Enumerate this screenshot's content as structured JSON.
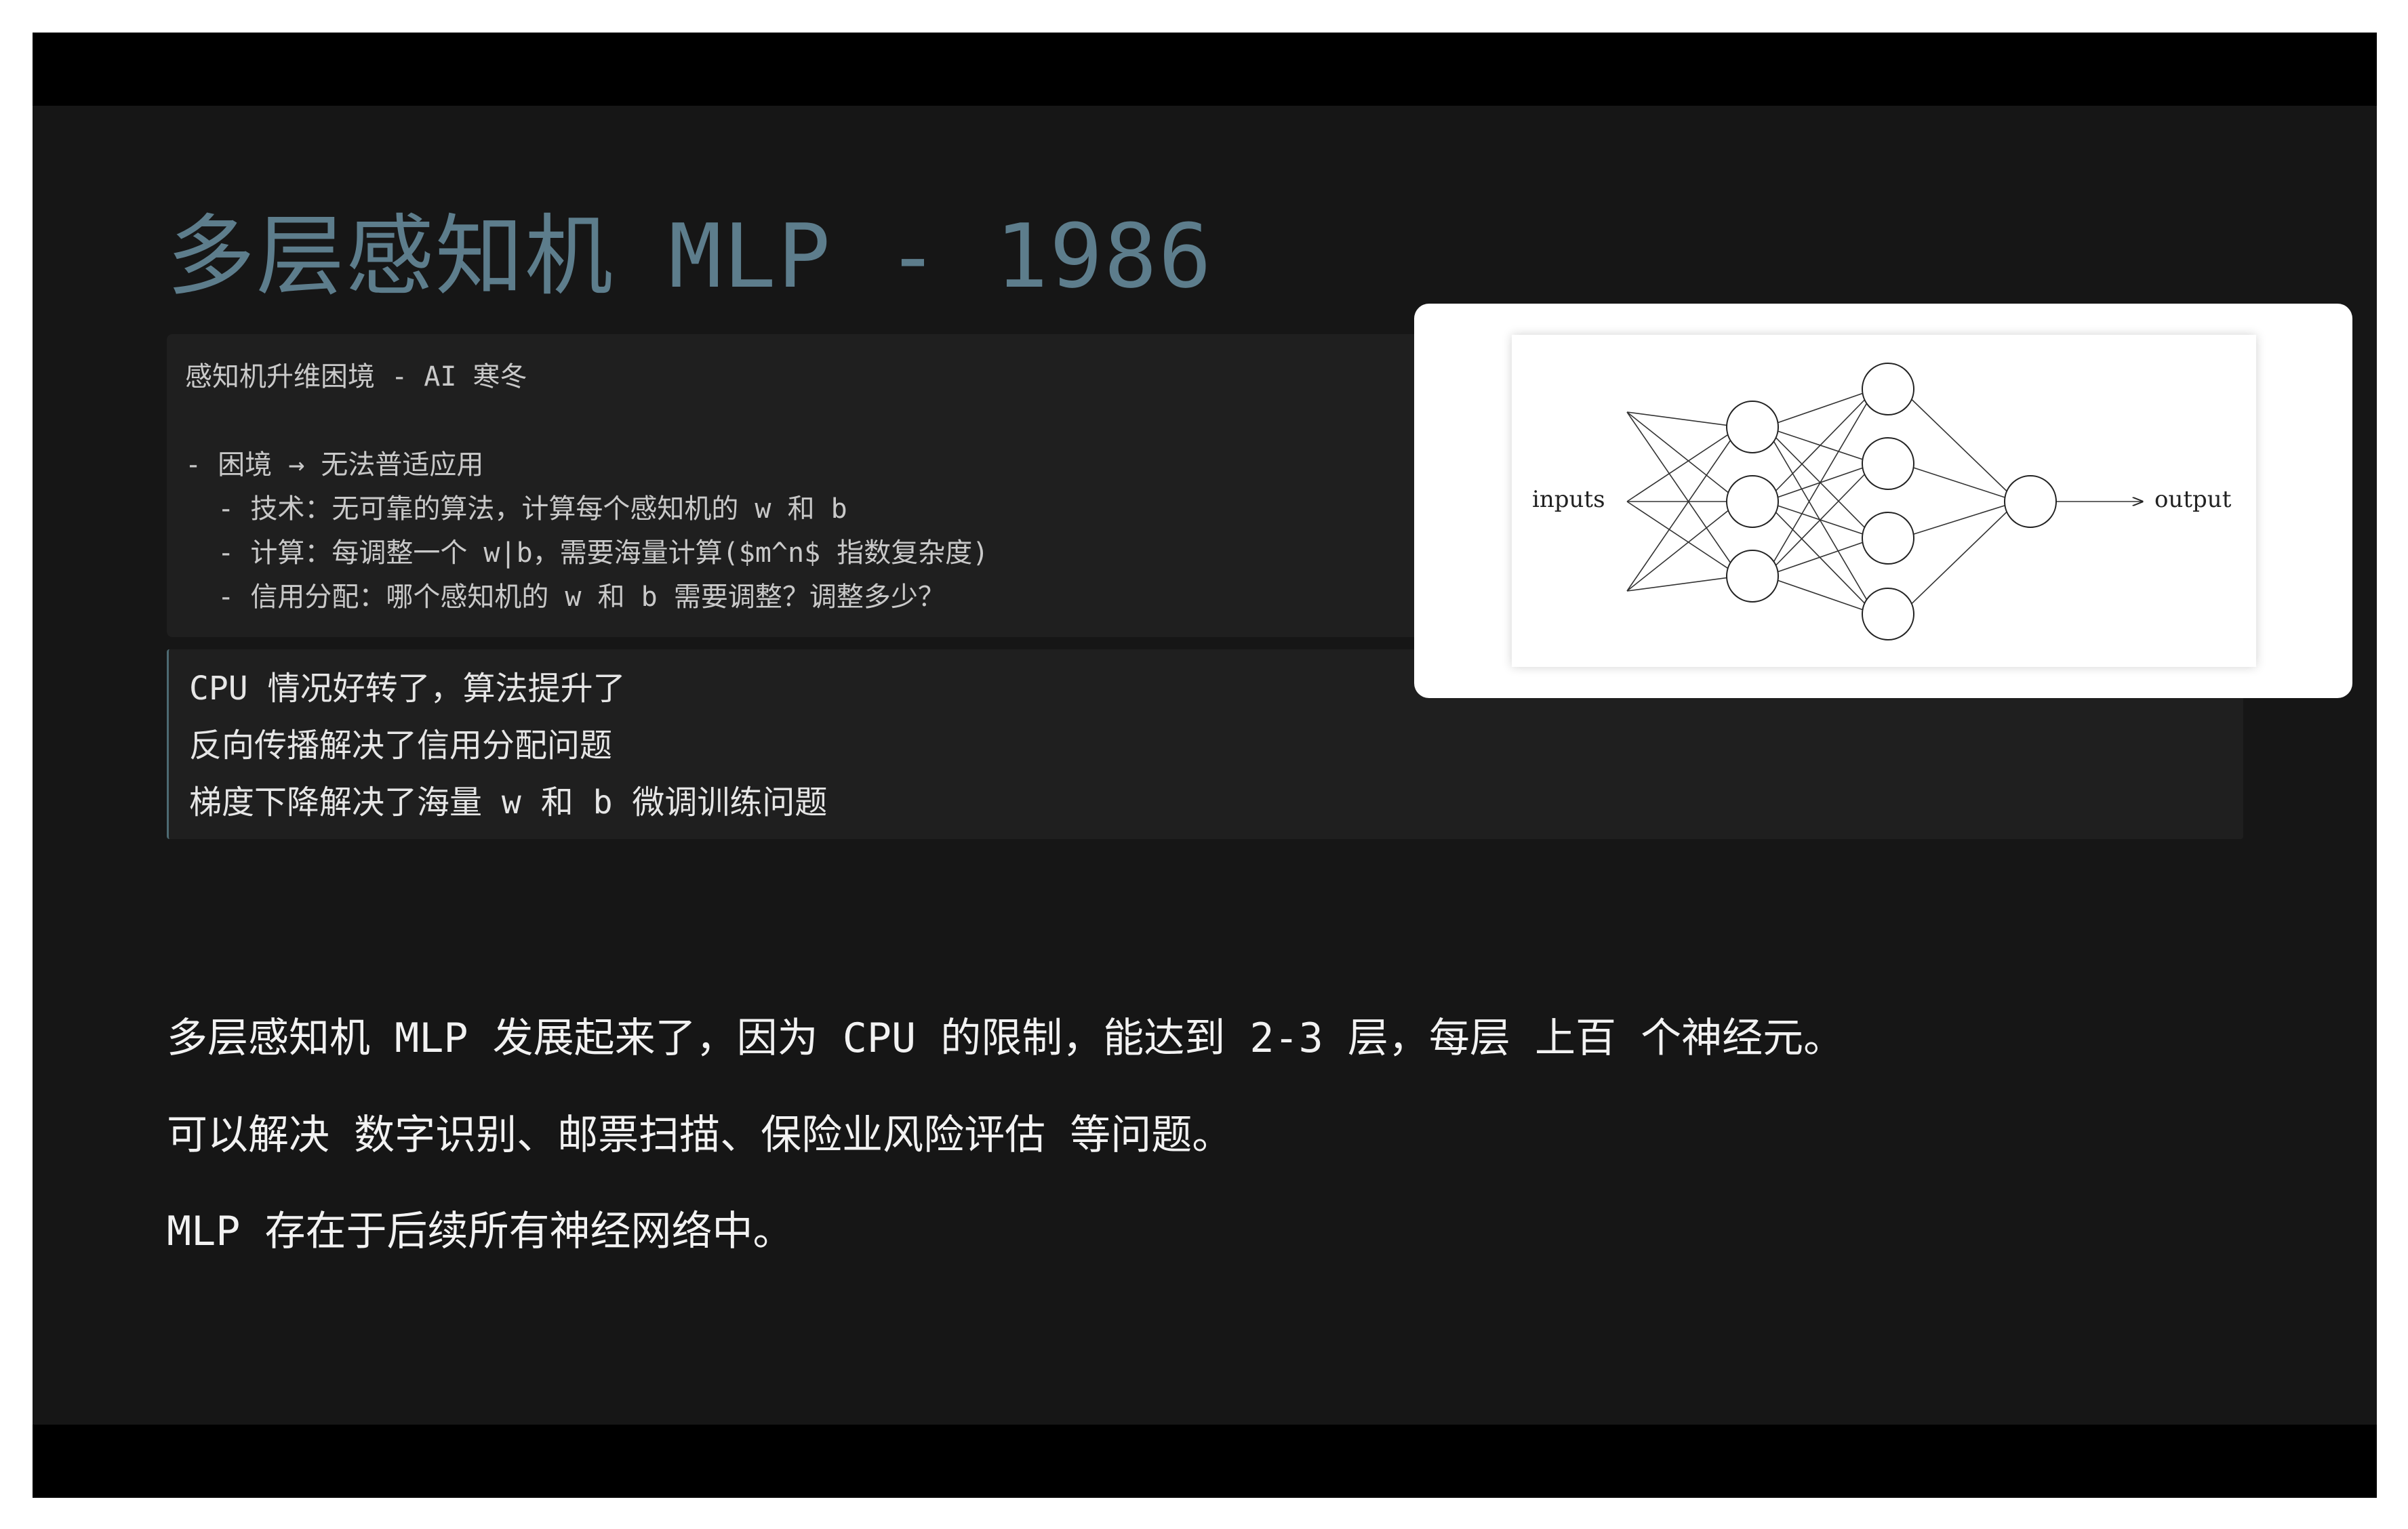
{
  "slide": {
    "title": "多层感知机 MLP - 1986",
    "code_block": {
      "lines": [
        "感知机升维困境 - AI 寒冬",
        "",
        "- 困境 → 无法普适应用",
        "  - 技术：无可靠的算法，计算每个感知机的 w 和 b",
        "  - 计算：每调整一个 w|b，需要海量计算($m^n$ 指数复杂度)",
        "  - 信用分配：哪个感知机的 w 和 b 需要调整？调整多少？"
      ]
    },
    "quote": {
      "lines": [
        "CPU 情况好转了，算法提升了",
        "反向传播解决了信用分配问题",
        "梯度下降解决了海量 w 和 b 微调训练问题"
      ]
    },
    "figure": {
      "input_label": "inputs",
      "output_label": "output"
    },
    "paragraphs": [
      "多层感知机 MLP 发展起来了，因为 CPU 的限制，能达到 2-3 层，每层 上百 个神经元。",
      "可以解决 数字识别、邮票扫描、保险业风险评估 等问题。",
      "MLP 存在于后续所有神经网络中。"
    ]
  }
}
